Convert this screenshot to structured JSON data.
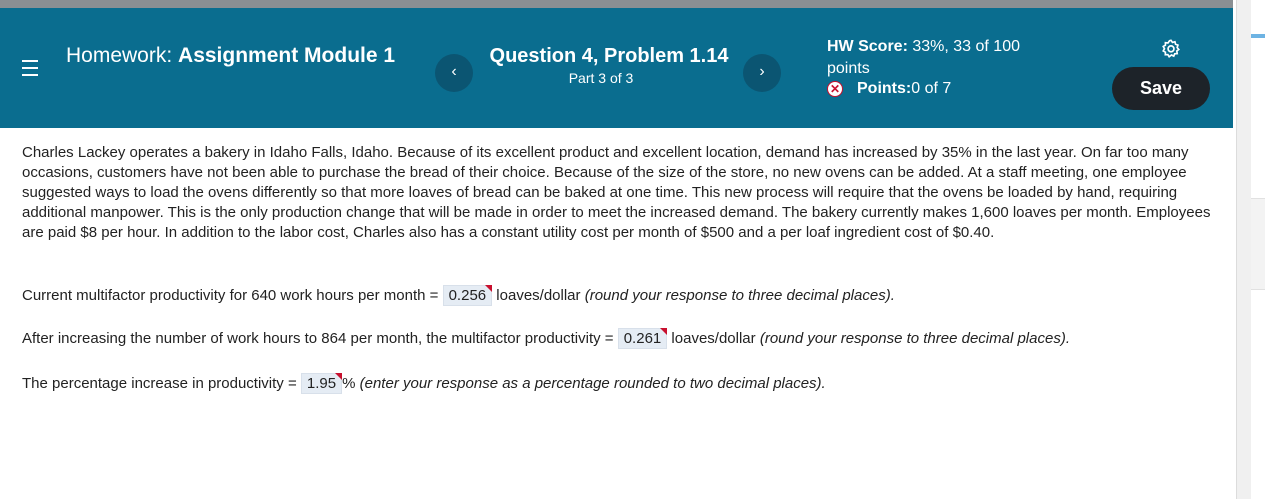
{
  "header": {
    "homework_prefix": "Homework: ",
    "homework_title": "Assignment Module 1",
    "question_title": "Question 4, Problem 1.14",
    "question_part": "Part 3 of 3",
    "hw_score_label": "HW Score:",
    "hw_score_value": " 33%, 33 of 100 points",
    "points_label": "Points:",
    "points_value": " 0 of 7",
    "save_label": "Save",
    "prev_glyph": "‹",
    "next_glyph": "›"
  },
  "problem": {
    "text": "Charles Lackey operates a bakery in Idaho Falls, Idaho.  Because of its excellent product and excellent location, demand has increased by 35% in the last year. On far too many occasions, customers have not been able to purchase the bread of their choice. Because of the size of the store, no new ovens can be added. At a staff meeting, one employee suggested ways to load the ovens differently so that more loaves of bread can be baked at one time. This new process will require that the ovens be loaded by hand, requiring additional manpower. This is the only production change that will be made in order to meet the increased demand. The bakery currently makes 1,600 loaves per month.  Employees are paid $8 per hour. In addition to the labor cost, Charles also has a constant utility cost per month of $500 and a per loaf ingredient cost of $0.40."
  },
  "questions": [
    {
      "prefix": "Current multifactor productivity for 640 work hours per month = ",
      "answer": "0.256",
      "unit": " loaves/dollar ",
      "hint": "(round your response to three decimal places)."
    },
    {
      "prefix": "After increasing the number of work hours to 864 per month, the multifactor productivity = ",
      "answer": "0.261",
      "unit": " loaves/dollar ",
      "hint": "(round your response to three decimal places)."
    },
    {
      "prefix": "The percentage increase in productivity = ",
      "answer": "1.95",
      "unit": "% ",
      "hint": "(enter your response as a percentage rounded to two decimal places)."
    }
  ],
  "icons": {
    "menu": "hamburger-menu-icon",
    "settings": "gear-icon",
    "incorrect": "x-circle-icon"
  },
  "colors": {
    "header_bg": "#0a6d8f",
    "save_bg": "#1d2329",
    "answer_bg": "#e5ecf4",
    "incorrect": "#c8102e"
  }
}
